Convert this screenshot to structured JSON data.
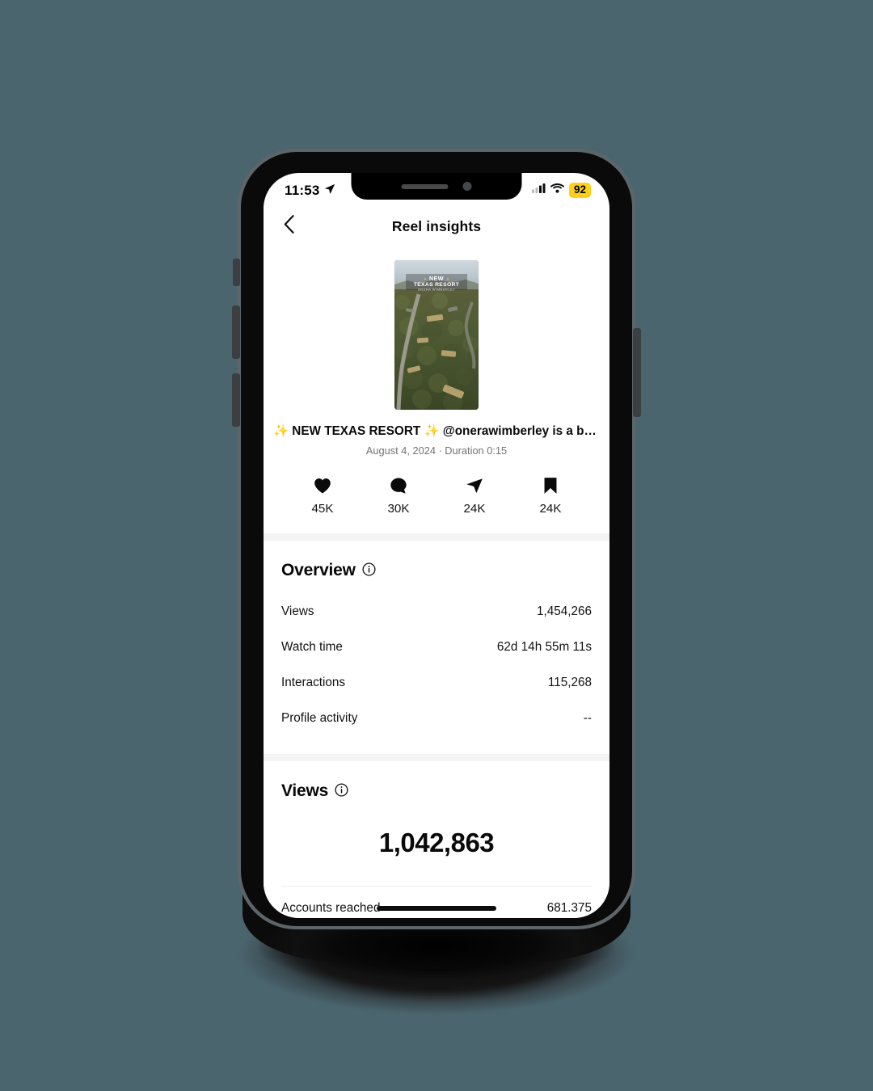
{
  "background_color": "#4b656e",
  "statusbar": {
    "time": "11:53",
    "location_icon": "location-arrow-icon",
    "cell_icon": "cellular-bars-icon",
    "wifi_icon": "wifi-icon",
    "battery_level": "92",
    "battery_color": "#fdd017"
  },
  "navbar": {
    "back_icon": "chevron-left-icon",
    "title": "Reel insights"
  },
  "reel": {
    "thumbnail_overlay": {
      "line1": "NEW",
      "line2": "TEXAS RESORT",
      "line3": "ONERA WIMBERLEY"
    },
    "caption_prefix_sparkle": "✨",
    "caption_main": " NEW TEXAS RESORT ",
    "caption_suffix_sparkle": "✨",
    "caption_rest": " @onerawimberley is a beau…",
    "meta": "August 4, 2024 · Duration 0:15"
  },
  "engagement": [
    {
      "icon": "heart-icon",
      "name": "likes",
      "value": "45K"
    },
    {
      "icon": "comment-icon",
      "name": "comments",
      "value": "30K"
    },
    {
      "icon": "share-icon",
      "name": "shares",
      "value": "24K"
    },
    {
      "icon": "bookmark-icon",
      "name": "saves",
      "value": "24K"
    }
  ],
  "overview": {
    "title": "Overview",
    "info_icon": "info-icon",
    "rows": [
      {
        "label": "Views",
        "value": "1,454,266"
      },
      {
        "label": "Watch time",
        "value": "62d 14h 55m 11s"
      },
      {
        "label": "Interactions",
        "value": "115,268"
      },
      {
        "label": "Profile activity",
        "value": "--"
      }
    ]
  },
  "views": {
    "title": "Views",
    "info_icon": "info-icon",
    "total": "1,042,863",
    "accounts_reached_label": "Accounts reached",
    "accounts_reached_value": "681.375"
  }
}
